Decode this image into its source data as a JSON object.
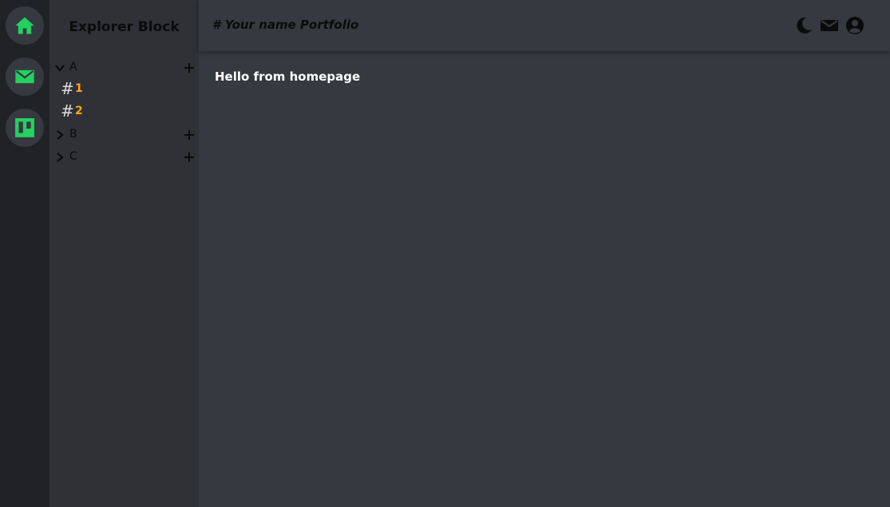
{
  "rail": {
    "items": [
      {
        "icon": "home-icon"
      },
      {
        "icon": "mail-icon"
      },
      {
        "icon": "trello-icon"
      }
    ],
    "accent_color": "#23d160"
  },
  "explorer": {
    "title": "Explorer Block",
    "folders": [
      {
        "label": "A",
        "expanded": true,
        "channels": [
          {
            "label": "1"
          },
          {
            "label": "2"
          }
        ]
      },
      {
        "label": "B",
        "expanded": false,
        "channels": []
      },
      {
        "label": "C",
        "expanded": false,
        "channels": []
      }
    ],
    "channel_prefix": "#",
    "channel_color": "#faa61a"
  },
  "header": {
    "title": "# Your name Portfolio",
    "icons": [
      "moon-icon",
      "mail-icon",
      "user-circle-icon"
    ]
  },
  "main": {
    "message": "Hello from homepage"
  }
}
